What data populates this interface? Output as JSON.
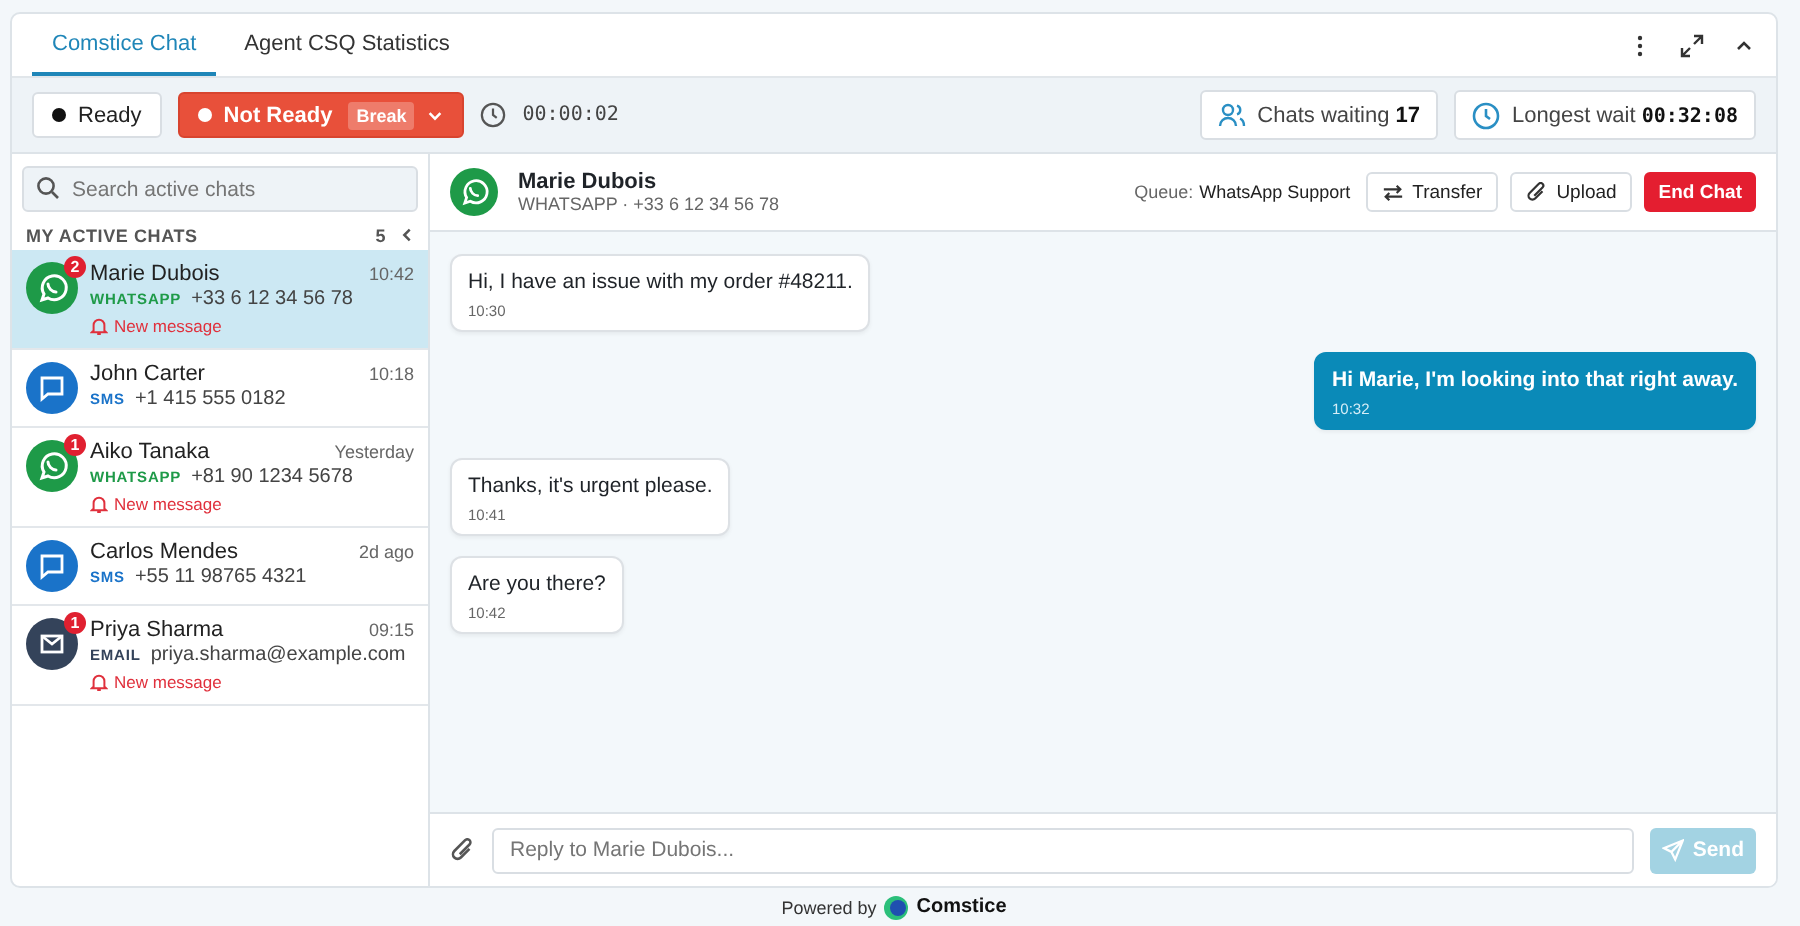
{
  "tabs": [
    {
      "label": "Comstice Chat",
      "selected": true
    },
    {
      "label": "Agent CSQ Statistics",
      "selected": false
    }
  ],
  "status": {
    "options": [
      {
        "label": "Ready",
        "selected": false
      },
      {
        "label": "Not Ready",
        "reason": "Break",
        "selected": true
      }
    ],
    "timer": "00:00:02"
  },
  "queue_stats": {
    "waiting_label": "Chats waiting",
    "waiting_count": "17",
    "longest_label": "Longest wait",
    "longest_value": "00:32:08"
  },
  "sidebar": {
    "search_placeholder": "Search active chats",
    "heading": "MY ACTIVE CHATS",
    "count": "5",
    "chats": [
      {
        "name": "Marie Dubois",
        "kind": "whatsapp",
        "channel_label": "WHATSAPP",
        "contact": "+33 6 12 34 56 78",
        "time": "10:42",
        "badge": "2",
        "alert": "New message",
        "selected": true
      },
      {
        "name": "John Carter",
        "kind": "sms",
        "channel_label": "SMS",
        "contact": "+1 415 555 0182",
        "time": "10:18",
        "selected": false
      },
      {
        "name": "Aiko Tanaka",
        "kind": "whatsapp",
        "channel_label": "WHATSAPP",
        "contact": "+81 90 1234 5678",
        "time": "Yesterday",
        "badge": "1",
        "alert": "New message",
        "selected": false
      },
      {
        "name": "Carlos Mendes",
        "kind": "sms",
        "channel_label": "SMS",
        "contact": "+55 11 98765 4321",
        "time": "2d ago",
        "selected": false
      },
      {
        "name": "Priya Sharma",
        "kind": "email",
        "channel_label": "EMAIL",
        "contact": "priya.sharma@example.com",
        "time": "09:15",
        "badge": "1",
        "alert": "New message",
        "selected": false
      }
    ]
  },
  "conversation": {
    "name": "Marie Dubois",
    "kind": "whatsapp",
    "subtitle": "WHATSAPP · +33 6 12 34 56 78",
    "queue_label": "Queue:",
    "queue": "WhatsApp Support",
    "actions": [
      "Transfer",
      "Upload"
    ],
    "end_label": "End Chat",
    "messages": [
      {
        "kind": "in",
        "text": "Hi, I have an issue with my order #48211.",
        "time": "10:30"
      },
      {
        "kind": "out",
        "text": "Hi Marie, I'm looking into that right away.",
        "time": "10:32"
      },
      {
        "kind": "in",
        "text": "Thanks, it's urgent please.",
        "time": "10:41"
      },
      {
        "kind": "in",
        "text": "Are you there?",
        "time": "10:42"
      }
    ],
    "reply_placeholder": "Reply to Marie Dubois...",
    "send_label": "Send",
    "send_disabled": true
  },
  "footer": {
    "label": "Powered by",
    "brand": "Comstice"
  }
}
